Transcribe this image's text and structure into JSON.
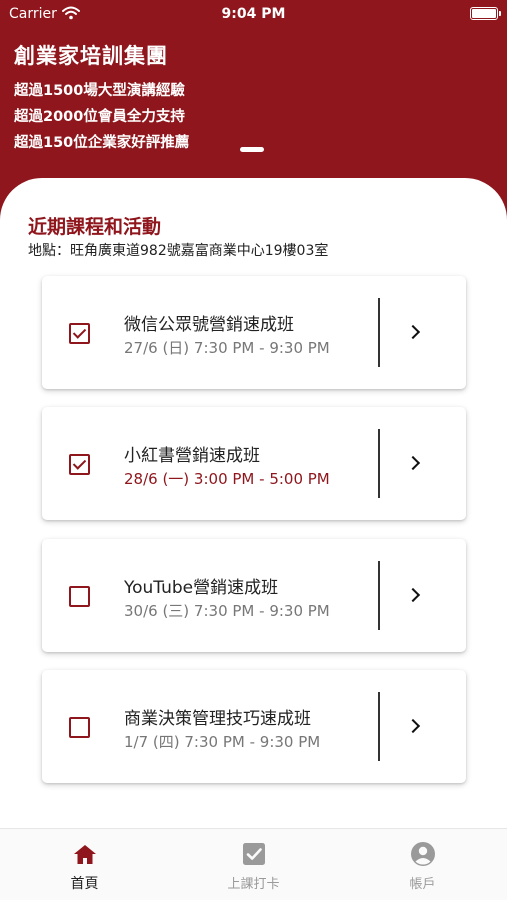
{
  "status_bar": {
    "carrier": "Carrier",
    "time": "9:04 PM"
  },
  "header": {
    "title": "創業家培訓集團",
    "taglines": [
      "超過1500場大型演講經驗",
      "超過2000位會員全力支持",
      "超過150位企業家好評推薦"
    ]
  },
  "section": {
    "title": "近期課程和活動",
    "address": "地點：旺角廣東道982號嘉富商業中心19樓03室"
  },
  "courses": [
    {
      "title": "微信公眾號營銷速成班",
      "time": "27/6 (日) 7:30 PM - 9:30 PM",
      "checked": true,
      "highlighted": false
    },
    {
      "title": "小紅書營銷速成班",
      "time": "28/6 (一) 3:00 PM - 5:00 PM",
      "checked": true,
      "highlighted": true
    },
    {
      "title": "YouTube營銷速成班",
      "time": "30/6 (三) 7:30 PM - 9:30 PM",
      "checked": false,
      "highlighted": false
    },
    {
      "title": "商業決策管理技巧速成班",
      "time": "1/7 (四) 7:30 PM - 9:30 PM",
      "checked": false,
      "highlighted": false
    }
  ],
  "tabs": [
    {
      "label": "首頁",
      "icon": "home-icon",
      "active": true
    },
    {
      "label": "上課打卡",
      "icon": "checkbox-icon",
      "active": false
    },
    {
      "label": "帳戶",
      "icon": "account-icon",
      "active": false
    }
  ],
  "colors": {
    "brand": "#8e161c",
    "inactive_tab": "#9a9a9a"
  }
}
